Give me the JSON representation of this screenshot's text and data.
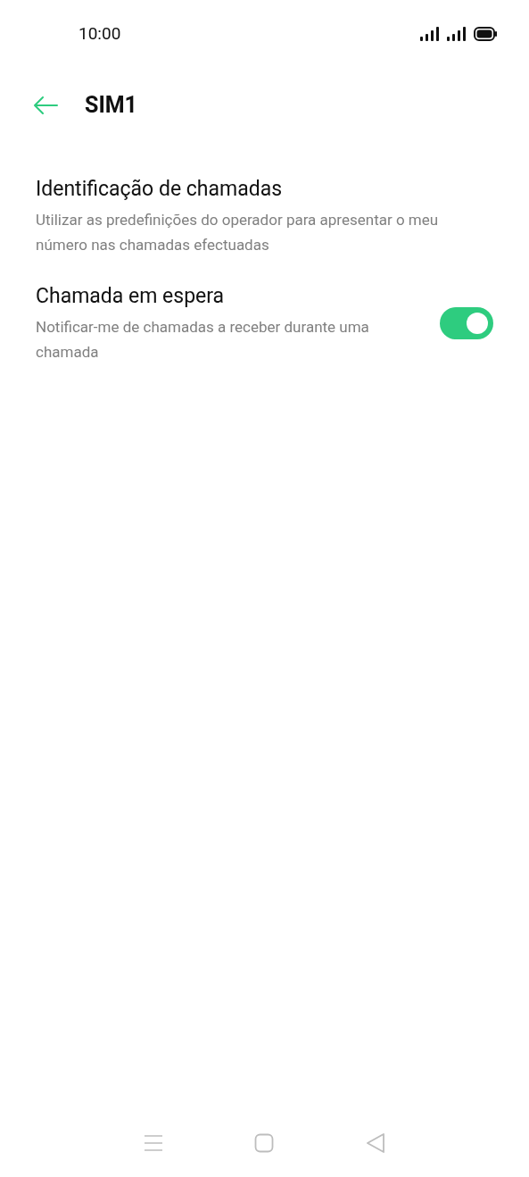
{
  "status_bar": {
    "time": "10:00"
  },
  "header": {
    "title": "SIM1"
  },
  "settings": [
    {
      "kind": "text",
      "title": "Identificação de chamadas",
      "subtitle": "Utilizar as predefinições do operador para apresentar o meu número nas chamadas efectuadas"
    },
    {
      "kind": "switch",
      "title": "Chamada em espera",
      "subtitle": "Notificar-me de chamadas a receber durante uma chamada",
      "on": true
    }
  ]
}
